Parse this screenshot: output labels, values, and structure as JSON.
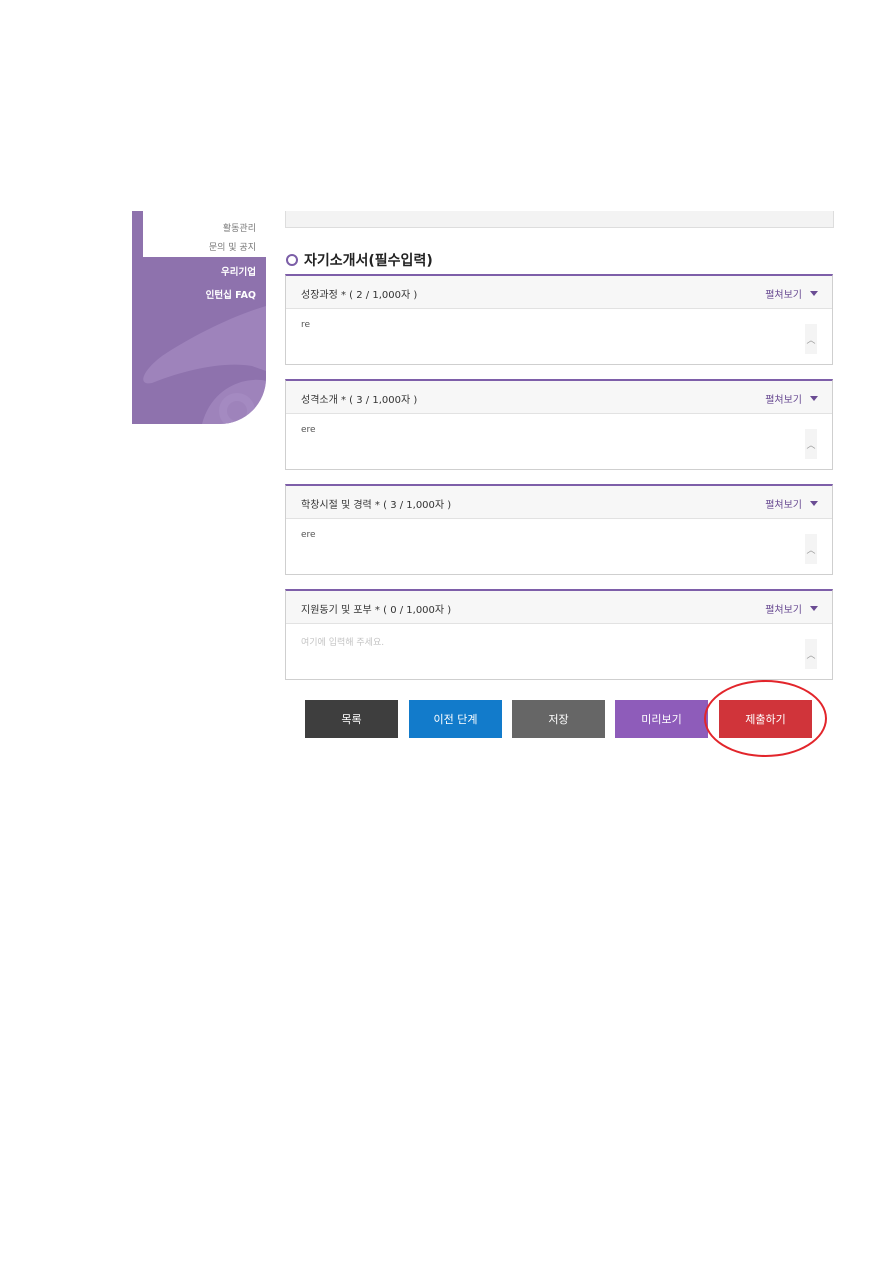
{
  "sidebar": {
    "sub_items": [
      "활동관리",
      "문의 및 공지"
    ],
    "main_items": [
      "우리기업",
      "인턴십 FAQ"
    ],
    "color": "#8e72ad"
  },
  "section": {
    "title": "자기소개서(필수입력)"
  },
  "fields": [
    {
      "label": "성장과정 * ( 2 / 1,000자 )",
      "expand": "펼쳐보기",
      "value": "re",
      "placeholder": ""
    },
    {
      "label": "성격소개 * ( 3 / 1,000자 )",
      "expand": "펼쳐보기",
      "value": "ere",
      "placeholder": ""
    },
    {
      "label": "학창시절 및 경력 * ( 3 / 1,000자 )",
      "expand": "펼쳐보기",
      "value": "ere",
      "placeholder": ""
    },
    {
      "label": "지원동기 및 포부 * ( 0 / 1,000자 )",
      "expand": "펼쳐보기",
      "value": "",
      "placeholder": "여기에 입력해 주세요."
    }
  ],
  "buttons": {
    "list": "목록",
    "prev": "이전 단계",
    "save": "저장",
    "preview": "미리보기",
    "submit": "제출하기"
  },
  "icons": {
    "expand": "triangle-down-icon",
    "scroll": "chevron-up-icon",
    "section": "circle-icon"
  },
  "colors": {
    "accent": "#7e5fa9",
    "submit": "#d0343a",
    "highlight": "#e2252b"
  }
}
